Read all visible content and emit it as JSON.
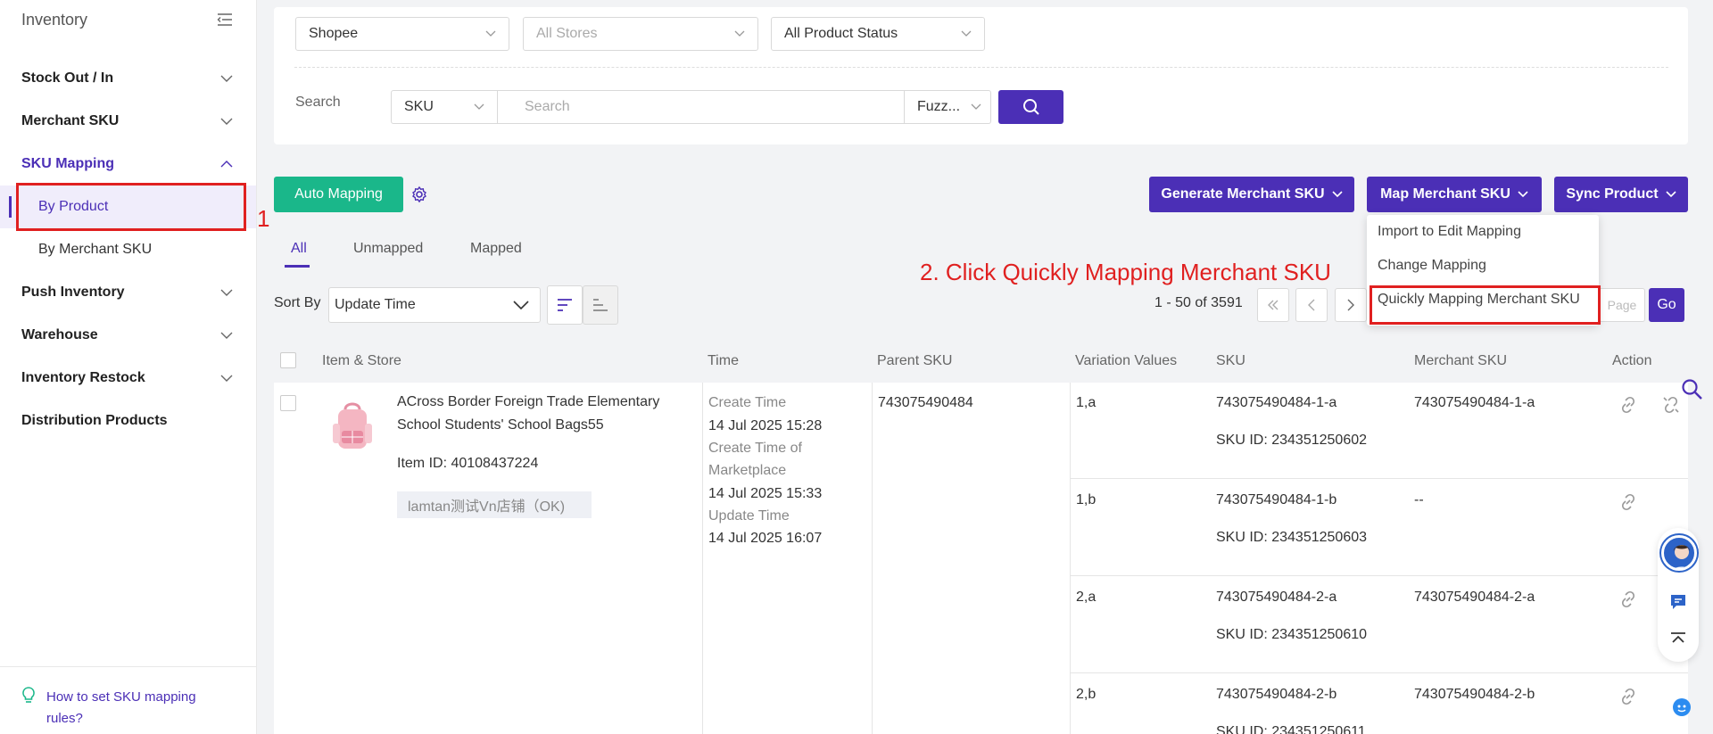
{
  "sidebar": {
    "title": "Inventory",
    "items": [
      {
        "label": "Stock Out / In"
      },
      {
        "label": "Merchant SKU"
      },
      {
        "label": "SKU Mapping"
      },
      {
        "label": "Push Inventory"
      },
      {
        "label": "Warehouse"
      },
      {
        "label": "Inventory Restock"
      },
      {
        "label": "Distribution Products"
      }
    ],
    "sub_items": [
      {
        "label": "By Product"
      },
      {
        "label": "By Merchant SKU"
      }
    ],
    "help_text": "How to set SKU mapping rules?"
  },
  "annotations": {
    "step1": "1",
    "step2": "2. Click Quickly Mapping Merchant SKU"
  },
  "filters": {
    "platform": "Shopee",
    "stores": "All Stores",
    "status": "All Product Status",
    "search_label": "Search",
    "search_field": "SKU",
    "search_placeholder": "Search",
    "match_mode": "Fuzz..."
  },
  "toolbar": {
    "auto_mapping": "Auto Mapping",
    "generate": "Generate Merchant SKU",
    "map": "Map Merchant SKU",
    "sync": "Sync Product"
  },
  "tabs": [
    {
      "label": "All"
    },
    {
      "label": "Unmapped"
    },
    {
      "label": "Mapped"
    }
  ],
  "dropdown": {
    "items": [
      {
        "label": "Import to Edit Mapping"
      },
      {
        "label": "Change Mapping"
      },
      {
        "label": "Quickly Mapping Merchant SKU"
      }
    ]
  },
  "sort": {
    "label": "Sort By",
    "value": "Update Time"
  },
  "pagination": {
    "info": "1 - 50 of 3591",
    "page_placeholder": "Page",
    "go": "Go"
  },
  "table": {
    "headers": {
      "item_store": "Item & Store",
      "time": "Time",
      "parent_sku": "Parent SKU",
      "variation": "Variation Values",
      "sku": "SKU",
      "merchant_sku": "Merchant SKU",
      "action": "Action"
    },
    "product": {
      "title_line1": "ACross Border Foreign Trade Elementary",
      "title_line2": "School Students' School Bags55",
      "item_id": "Item ID: 40108437224",
      "store": "lamtan测试Vn店铺（OK)",
      "create_time_label": "Create Time",
      "create_time": "14 Jul 2025 15:28",
      "market_time_label_1": "Create Time of",
      "market_time_label_2": "Marketplace",
      "market_time": "14 Jul 2025 15:33",
      "update_time_label": "Update Time",
      "update_time": "14 Jul 2025 16:07",
      "parent_sku": "743075490484"
    },
    "variations": [
      {
        "variation": "1,a",
        "sku": "743075490484-1-a",
        "sku_id": "SKU ID: 234351250602",
        "merchant_sku": "743075490484-1-a"
      },
      {
        "variation": "1,b",
        "sku": "743075490484-1-b",
        "sku_id": "SKU ID: 234351250603",
        "merchant_sku": "--"
      },
      {
        "variation": "2,a",
        "sku": "743075490484-2-a",
        "sku_id": "SKU ID: 234351250610",
        "merchant_sku": "743075490484-2-a"
      },
      {
        "variation": "2,b",
        "sku": "743075490484-2-b",
        "sku_id": "SKU ID: 234351250611",
        "merchant_sku": "743075490484-2-b"
      }
    ]
  },
  "colors": {
    "primary": "#4b2fb6",
    "green": "#1ab78a",
    "annotation_red": "#e02020"
  }
}
